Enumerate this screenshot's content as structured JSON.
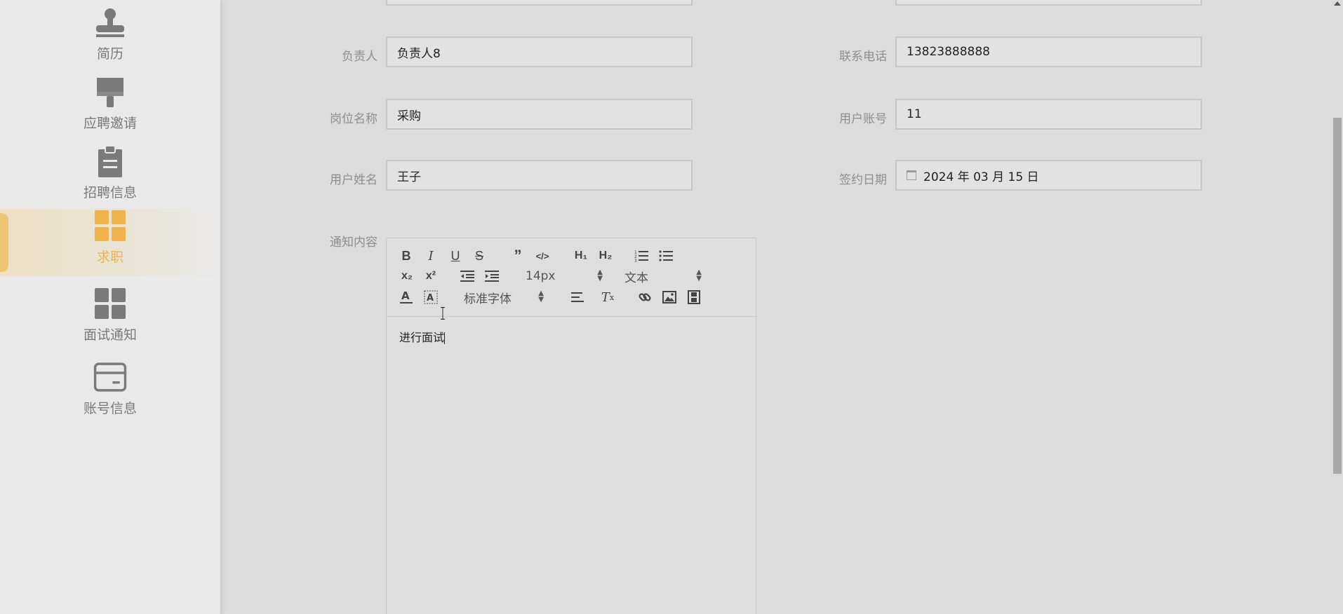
{
  "sidebar": {
    "items": [
      {
        "label": "简历",
        "icon": "stamp-icon",
        "active": false
      },
      {
        "label": "应聘邀请",
        "icon": "brush-icon",
        "active": false
      },
      {
        "label": "招聘信息",
        "icon": "clipboard-icon",
        "active": false
      },
      {
        "label": "求职",
        "icon": "grid-icon",
        "active": true
      },
      {
        "label": "面试通知",
        "icon": "grid-icon",
        "active": false
      },
      {
        "label": "账号信息",
        "icon": "card-icon",
        "active": false
      }
    ]
  },
  "form": {
    "responsible_person": {
      "label": "负责人",
      "value": "负责人8"
    },
    "contact_phone": {
      "label": "联系电话",
      "value": "13823888888"
    },
    "job_title": {
      "label": "岗位名称",
      "value": "采购"
    },
    "user_account": {
      "label": "用户账号",
      "value": "11"
    },
    "user_name": {
      "label": "用户姓名",
      "value": "王子"
    },
    "sign_date": {
      "label": "签约日期",
      "value": "2024 年 03 月 15 日"
    },
    "notice_content": {
      "label": "通知内容"
    }
  },
  "editor": {
    "font_size": "14px",
    "text_type": "文本",
    "font_family": "标准字体",
    "content": "进行面试"
  },
  "colors": {
    "accent": "#f0b24a",
    "sidebar_bg": "#e9e9e9",
    "page_bg": "#dcdcdc",
    "icon_gray": "#7a7a7a"
  }
}
